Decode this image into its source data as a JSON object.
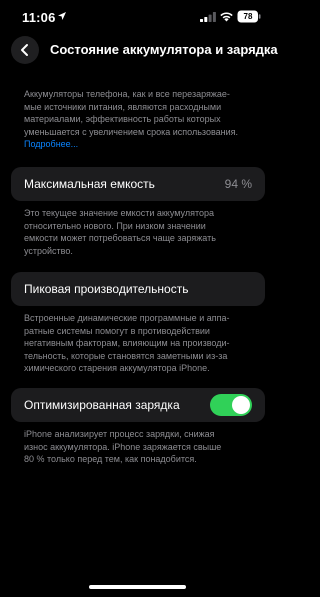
{
  "status_bar": {
    "time": "11:06",
    "battery": "78",
    "icons": [
      "location-arrow-icon",
      "cellular-signal-icon",
      "wifi-icon",
      "battery-icon"
    ]
  },
  "nav": {
    "back_icon": "chevron-left-icon",
    "title": "Состояние аккумулятора и зарядка"
  },
  "intro": {
    "lines": [
      "Аккумуляторы телефона, как и все перезаряжае-",
      "мые источники питания, являются расходными",
      "материалами, эффективность работы которых",
      "уменьшается с увеличением срока использования."
    ],
    "link": "Подробнее..."
  },
  "max_capacity": {
    "label": "Максимальная емкость",
    "value": "94 %",
    "description_lines": [
      "Это текущее значение емкости аккумулятора",
      "относительно нового. При низком значении",
      "емкости может потребоваться чаще заряжать",
      "устройство."
    ]
  },
  "peak_performance": {
    "label": "Пиковая производительность",
    "description_lines": [
      "Встроенные динамические программные и аппа-",
      "ратные системы помогут в противодействии",
      "негативным факторам, влияющим на производи-",
      "тельность, которые становятся заметными из-за",
      "химического старения аккумулятора iPhone."
    ]
  },
  "optimized_charging": {
    "label": "Оптимизированная зарядка",
    "enabled": true,
    "toggle_color": "#30d158",
    "description_lines": [
      "iPhone анализирует процесс зарядки, снижая",
      "износ аккумулятора. iPhone заряжается свыше",
      "80 % только перед тем, как понадобится."
    ]
  },
  "colors": {
    "background": "#000000",
    "card": "#1c1c1e",
    "secondary_text": "#8d8d92",
    "link": "#0a84ff"
  }
}
